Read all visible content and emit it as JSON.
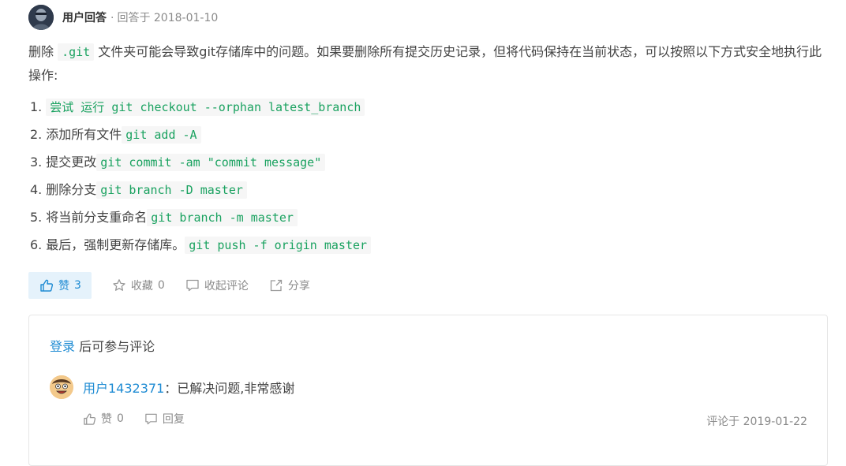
{
  "answer": {
    "author": "用户回答",
    "meta": "回答于 2018-01-10",
    "intro_before": "删除 ",
    "intro_code": ".git",
    "intro_after": " 文件夹可能会导致git存储库中的问题。如果要删除所有提交历史记录，但将代码保持在当前状态，可以按照以下方式安全地执行此操作:",
    "steps": [
      {
        "num": "1.",
        "text": "",
        "code": "尝试  运行  git checkout --orphan latest_branch"
      },
      {
        "num": "2.",
        "text": "添加所有文件",
        "code": "git add -A"
      },
      {
        "num": "3.",
        "text": "提交更改",
        "code": "git commit -am \"commit message\""
      },
      {
        "num": "4.",
        "text": "删除分支",
        "code": "git branch -D master"
      },
      {
        "num": "5.",
        "text": "将当前分支重命名",
        "code": "git branch -m master"
      },
      {
        "num": "6.",
        "text": "最后，强制更新存储库。",
        "code": "git push -f origin master"
      }
    ]
  },
  "actions": {
    "like_label": "赞",
    "like_count": "3",
    "favorite_label": "收藏",
    "favorite_count": "0",
    "collapse_comments_label": "收起评论",
    "share_label": "分享"
  },
  "comments": {
    "login_link": "登录",
    "login_suffix": " 后可参与评论",
    "items": [
      {
        "user": "用户1432371",
        "separator": "：",
        "text": "已解决问题,非常感谢",
        "like_label": "赞",
        "like_count": "0",
        "reply_label": "回复",
        "date": "评论于 2019-01-22"
      }
    ]
  },
  "colors": {
    "accent": "#1e8bd3",
    "code": "#1aa260",
    "muted": "#8a8a8a",
    "like_bg": "#e5f2fb"
  }
}
